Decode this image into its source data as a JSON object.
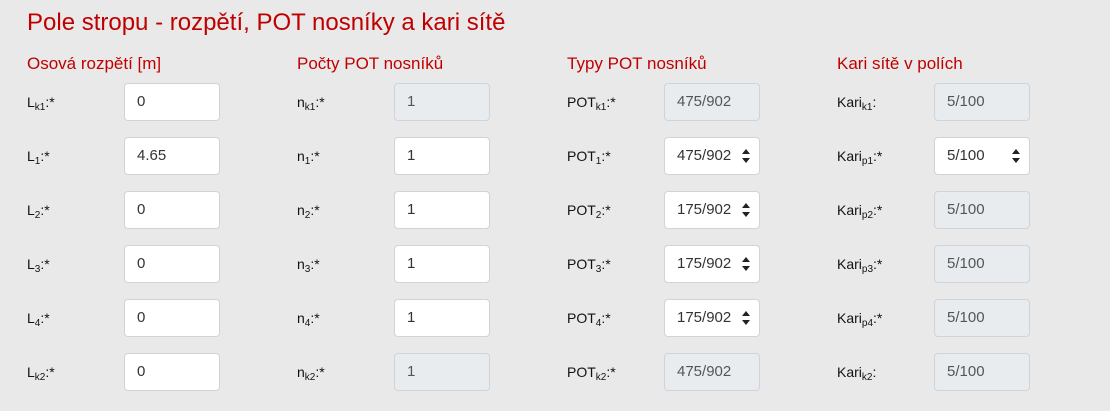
{
  "title": "Pole stropu - rozpětí, POT nosníky a kari sítě",
  "columns": [
    {
      "header": "Osová rozpětí [m]",
      "rows": [
        {
          "base": "L",
          "sub": "k1",
          "suffix": ":*",
          "value": "0",
          "type": "input",
          "readonly": false
        },
        {
          "base": "L",
          "sub": "1",
          "suffix": ":*",
          "value": "4.65",
          "type": "input",
          "readonly": false
        },
        {
          "base": "L",
          "sub": "2",
          "suffix": ":*",
          "value": "0",
          "type": "input",
          "readonly": false
        },
        {
          "base": "L",
          "sub": "3",
          "suffix": ":*",
          "value": "0",
          "type": "input",
          "readonly": false
        },
        {
          "base": "L",
          "sub": "4",
          "suffix": ":*",
          "value": "0",
          "type": "input",
          "readonly": false
        },
        {
          "base": "L",
          "sub": "k2",
          "suffix": ":*",
          "value": "0",
          "type": "input",
          "readonly": false
        }
      ]
    },
    {
      "header": "Počty POT nosníků",
      "rows": [
        {
          "base": "n",
          "sub": "k1",
          "suffix": ":*",
          "value": "1",
          "type": "input",
          "readonly": true
        },
        {
          "base": "n",
          "sub": "1",
          "suffix": ":*",
          "value": "1",
          "type": "input",
          "readonly": false
        },
        {
          "base": "n",
          "sub": "2",
          "suffix": ":*",
          "value": "1",
          "type": "input",
          "readonly": false
        },
        {
          "base": "n",
          "sub": "3",
          "suffix": ":*",
          "value": "1",
          "type": "input",
          "readonly": false
        },
        {
          "base": "n",
          "sub": "4",
          "suffix": ":*",
          "value": "1",
          "type": "input",
          "readonly": false
        },
        {
          "base": "n",
          "sub": "k2",
          "suffix": ":*",
          "value": "1",
          "type": "input",
          "readonly": true
        }
      ]
    },
    {
      "header": "Typy POT nosníků",
      "rows": [
        {
          "base": "POT",
          "sub": "k1",
          "suffix": ":*",
          "value": "475/902",
          "type": "input",
          "readonly": true
        },
        {
          "base": "POT",
          "sub": "1",
          "suffix": ":*",
          "value": "475/902",
          "type": "select",
          "readonly": false
        },
        {
          "base": "POT",
          "sub": "2",
          "suffix": ":*",
          "value": "175/902",
          "type": "select",
          "readonly": false
        },
        {
          "base": "POT",
          "sub": "3",
          "suffix": ":*",
          "value": "175/902",
          "type": "select",
          "readonly": false
        },
        {
          "base": "POT",
          "sub": "4",
          "suffix": ":*",
          "value": "175/902",
          "type": "select",
          "readonly": false
        },
        {
          "base": "POT",
          "sub": "k2",
          "suffix": ":*",
          "value": "475/902",
          "type": "input",
          "readonly": true
        }
      ]
    },
    {
      "header": "Kari sítě v polích",
      "rows": [
        {
          "base": "Kari",
          "sub": "k1",
          "suffix": ":",
          "value": "5/100",
          "type": "input",
          "readonly": true
        },
        {
          "base": "Kari",
          "sub": "p1",
          "suffix": ":*",
          "value": "5/100",
          "type": "select",
          "readonly": false
        },
        {
          "base": "Kari",
          "sub": "p2",
          "suffix": ":*",
          "value": "5/100",
          "type": "input",
          "readonly": true
        },
        {
          "base": "Kari",
          "sub": "p3",
          "suffix": ":*",
          "value": "5/100",
          "type": "input",
          "readonly": true
        },
        {
          "base": "Kari",
          "sub": "p4",
          "suffix": ":*",
          "value": "5/100",
          "type": "input",
          "readonly": true
        },
        {
          "base": "Kari",
          "sub": "k2",
          "suffix": ":",
          "value": "5/100",
          "type": "input",
          "readonly": true
        }
      ]
    }
  ]
}
